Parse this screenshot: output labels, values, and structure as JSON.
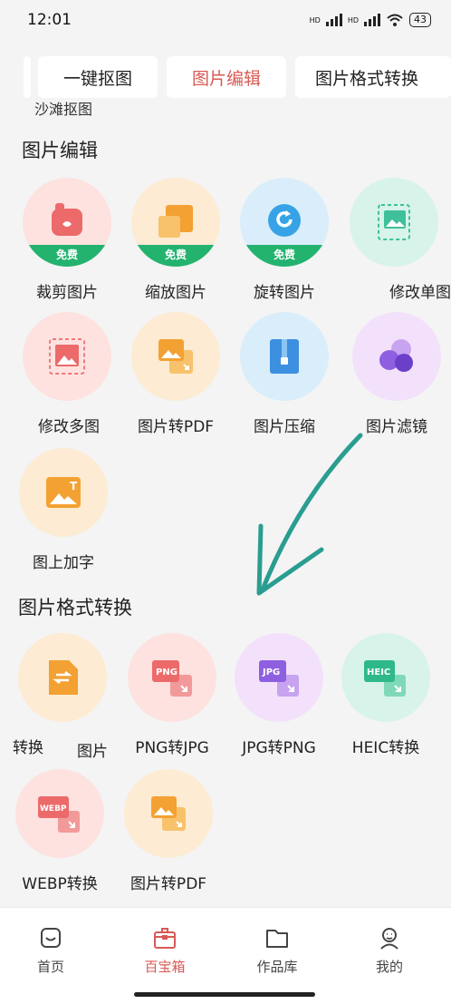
{
  "status_bar": {
    "time": "12:01",
    "hd1": "HD",
    "hd2": "HD",
    "battery": "43"
  },
  "tabs": [
    {
      "label": "一键抠图"
    },
    {
      "label": "图片编辑"
    },
    {
      "label": "图片格式转换"
    }
  ],
  "sub_text": "沙滩抠图",
  "edit_section": {
    "title": "图片编辑",
    "items": [
      {
        "label": "裁剪图片",
        "badge": "免费",
        "icon": "crop-icon"
      },
      {
        "label": "缩放图片",
        "badge": "免费",
        "icon": "resize-icon"
      },
      {
        "label": "旋转图片",
        "badge": "免费",
        "icon": "rotate-icon"
      },
      {
        "label": "修改单图",
        "icon": "edit-single-icon"
      },
      {
        "label": "修改多图",
        "icon": "edit-multi-icon"
      },
      {
        "label": "图片转PDF",
        "icon": "image-to-pdf-icon"
      },
      {
        "label": "图片压缩",
        "icon": "compress-icon"
      },
      {
        "label": "图片滤镜",
        "icon": "filter-icon"
      },
      {
        "label": "图上加字",
        "icon": "add-text-icon"
      }
    ]
  },
  "convert_section": {
    "title": "图片格式转换",
    "items": [
      {
        "label": "转换",
        "icon": "convert-icon"
      },
      {
        "label": "图片",
        "icon_text": "PNG",
        "icon": "png-icon"
      },
      {
        "label": "PNG转JPG",
        "icon_text": "JPG",
        "icon": "png-to-jpg-icon"
      },
      {
        "label": "JPG转PNG",
        "icon_text": "HEIC",
        "icon": "jpg-to-png-icon"
      },
      {
        "label": "HEIC转换",
        "icon": "heic-icon"
      },
      {
        "label": "WEBP转换",
        "icon_text": "WEBP",
        "icon": "webp-icon"
      },
      {
        "label": "图片转PDF",
        "icon": "image-to-pdf-icon"
      }
    ]
  },
  "bottom_nav": [
    {
      "label": "首页",
      "icon": "home-icon"
    },
    {
      "label": "百宝箱",
      "icon": "toolbox-icon",
      "active": true
    },
    {
      "label": "作品库",
      "icon": "folder-icon"
    },
    {
      "label": "我的",
      "icon": "profile-icon"
    }
  ],
  "colors": {
    "accent": "#d85a55",
    "free_badge": "#23b36f"
  }
}
